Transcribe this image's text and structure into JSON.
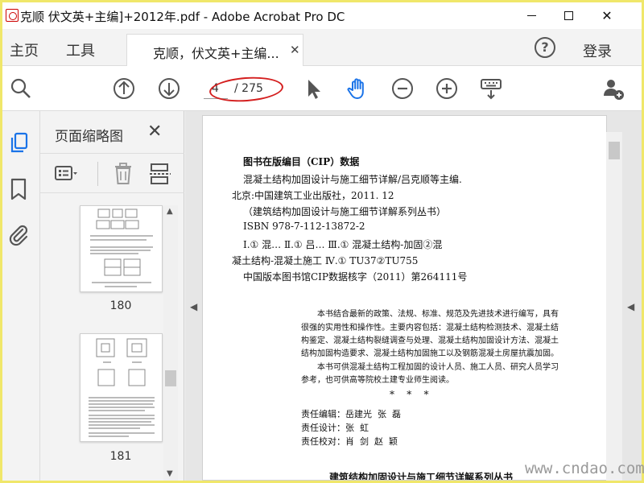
{
  "window": {
    "title": "克顺 伏文英+主编]+2012年.pdf - Adobe Acrobat Pro DC"
  },
  "tabbar": {
    "home_label": "主页",
    "tools_label": "工具",
    "document_tab_label": "克顺，伏文英+主编...",
    "login_label": "登录"
  },
  "toolbar": {
    "current_page": "4",
    "total_pages": "/ 275",
    "annotation_color": "#d41f1f",
    "active_tool_color": "#1a73e8"
  },
  "thumbnails": {
    "title": "页面缩略图",
    "pages": [
      {
        "label": "180"
      },
      {
        "label": "181"
      }
    ]
  },
  "page": {
    "cip_title": "图书在版编目（CIP）数据",
    "cip_lines": [
      "混凝土结构加固设计与施工细节详解/吕克顺等主编.",
      "北京:中国建筑工业出版社，2011. 12",
      "（建筑结构加固设计与施工细节详解系列丛书）",
      "ISBN 978-7-112-13872-2",
      "Ⅰ.① 混…  Ⅱ.① 吕…  Ⅲ.① 混凝土结构-加固②混",
      "凝土结构-混凝土施工  Ⅳ.① TU37②TU755",
      "中国版本图书馆CIP数据核字（2011）第264111号"
    ],
    "description_lines": [
      "本书结合最新的政策、法规、标准、规范及先进技术进行编写，具有",
      "很强的实用性和操作性。主要内容包括：混凝土结构检测技术、混凝土结",
      "构鉴定、混凝土结构裂缝调查与处理、混凝土结构加固设计方法、混凝土",
      "结构加固构造要求、混凝土结构加固施工以及钢筋混凝土房屋抗震加固。",
      "本书可供混凝土结构工程加固的设计人员、施工人员、研究人员学习",
      "参考，也可供高等院校土建专业师生阅读。"
    ],
    "stars": "*    *    *",
    "credits": [
      "责任编辑：岳建光  张  磊",
      "责任设计：张  虹",
      "责任校对：肖  剑  赵  颖"
    ],
    "series_title": "建筑结构加固设计与施工细节详解系列丛书"
  },
  "watermark": "www.cndao.com"
}
